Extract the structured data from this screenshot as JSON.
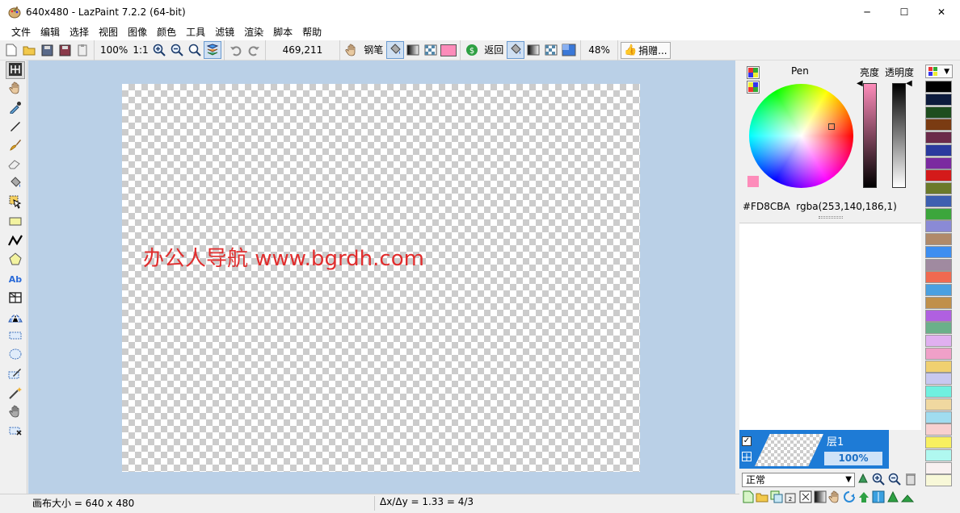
{
  "window": {
    "title": "640x480 - LazPaint 7.2.2 (64-bit)",
    "minimize": "─",
    "maximize": "☐",
    "close": "✕"
  },
  "menu": [
    "文件",
    "编辑",
    "选择",
    "视图",
    "图像",
    "颜色",
    "工具",
    "滤镜",
    "渲染",
    "脚本",
    "帮助"
  ],
  "toolbar": {
    "zoom": "100%",
    "zoom_ratio": "1:1",
    "coords": "469,211",
    "pen_label": "钢笔",
    "back_label": "返回",
    "opacity": "48%",
    "donate_label": "捐赠..."
  },
  "canvas": {
    "watermark": "办公人导航 www.bgrdh.com"
  },
  "color_panel": {
    "pen_label": "Pen",
    "brightness_label": "亮度",
    "alpha_label": "透明度",
    "hex": "#FD8CBA",
    "rgba": "rgba(253,140,186,1)",
    "pen_color": "#FD8CBA"
  },
  "layers": {
    "name": "层1",
    "opacity": "100%",
    "blend_mode": "正常"
  },
  "status": {
    "canvas_size": "画布大小 = 640 x 480",
    "ratio": "Δx/Δy = 1.33 = 4/3"
  },
  "palette": [
    "#000000",
    "#0d1b3d",
    "#1e4d1e",
    "#7a3b12",
    "#6b2a4a",
    "#2a3a9e",
    "#7b2aa0",
    "#d41a1a",
    "#6b7a2a",
    "#3d5fb0",
    "#3ca63c",
    "#8a8ad6",
    "#b08a6a",
    "#3d8ef0",
    "#a08aa0",
    "#f06a50",
    "#4aa0e0",
    "#c0904a",
    "#b060e0",
    "#6ab08a",
    "#e0b0f0",
    "#f0a0c8",
    "#f0d070",
    "#c8c8f0",
    "#70f0e0",
    "#f0d8a0",
    "#a0dcf0",
    "#f8d0d0",
    "#f8f060",
    "#b0f8f0",
    "#f8f0f0",
    "#f8f8d8"
  ]
}
